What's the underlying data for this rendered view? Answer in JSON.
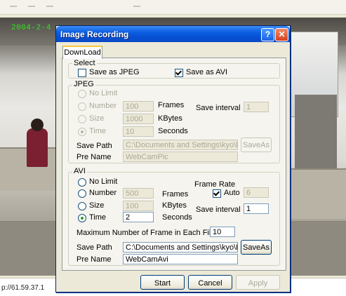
{
  "status": {
    "url": "p://61.59.37.1"
  },
  "overlay": {
    "timestamp": "2004-2-4"
  },
  "dialog": {
    "title": "Image Recording",
    "help_label": "?",
    "close_label": "✕",
    "tab_label": "DownLoad",
    "select": {
      "legend": "Select",
      "save_jpeg_label": "Save as JPEG",
      "save_jpeg_checked": false,
      "save_avi_label": "Save as AVI",
      "save_avi_checked": true
    },
    "jpeg": {
      "legend": "JPEG",
      "no_limit_label": "No Limit",
      "number_label": "Number",
      "number_value": "100",
      "frames_label": "Frames",
      "save_interval_label": "Save interval",
      "save_interval_value": "1",
      "size_label": "Size",
      "size_value": "1000",
      "kbytes_label": "KBytes",
      "time_label": "Time",
      "time_value": "10",
      "seconds_label": "Seconds",
      "save_path_label": "Save Path",
      "save_path_value": "C:\\Documents and Settings\\kyo\\Des",
      "save_as_label": "SaveAs",
      "pre_name_label": "Pre Name",
      "pre_name_value": "WebCamPic"
    },
    "avi": {
      "legend": "AVI",
      "no_limit_label": "No Limit",
      "frame_rate_label": "Frame Rate",
      "number_label": "Number",
      "number_value": "500",
      "frames_label": "Frames",
      "auto_label": "Auto",
      "auto_checked": true,
      "frame_rate_value": "6",
      "size_label": "Size",
      "size_value": "100",
      "kbytes_label": "KBytes",
      "save_interval_label": "Save interval",
      "save_interval_value": "1",
      "time_label": "Time",
      "time_value": "2",
      "seconds_label": "Seconds",
      "selected_mode": "Time",
      "max_frames_label": "Maximum Number of Frame in Each File",
      "max_frames_value": "10",
      "save_path_label": "Save Path",
      "save_path_value": "C:\\Documents and Settings\\kyo\\Des",
      "save_as_label": "SaveAs",
      "pre_name_label": "Pre Name",
      "pre_name_value": "WebCamAvi"
    },
    "buttons": {
      "start": "Start",
      "cancel": "Cancel",
      "apply": "Apply"
    }
  }
}
